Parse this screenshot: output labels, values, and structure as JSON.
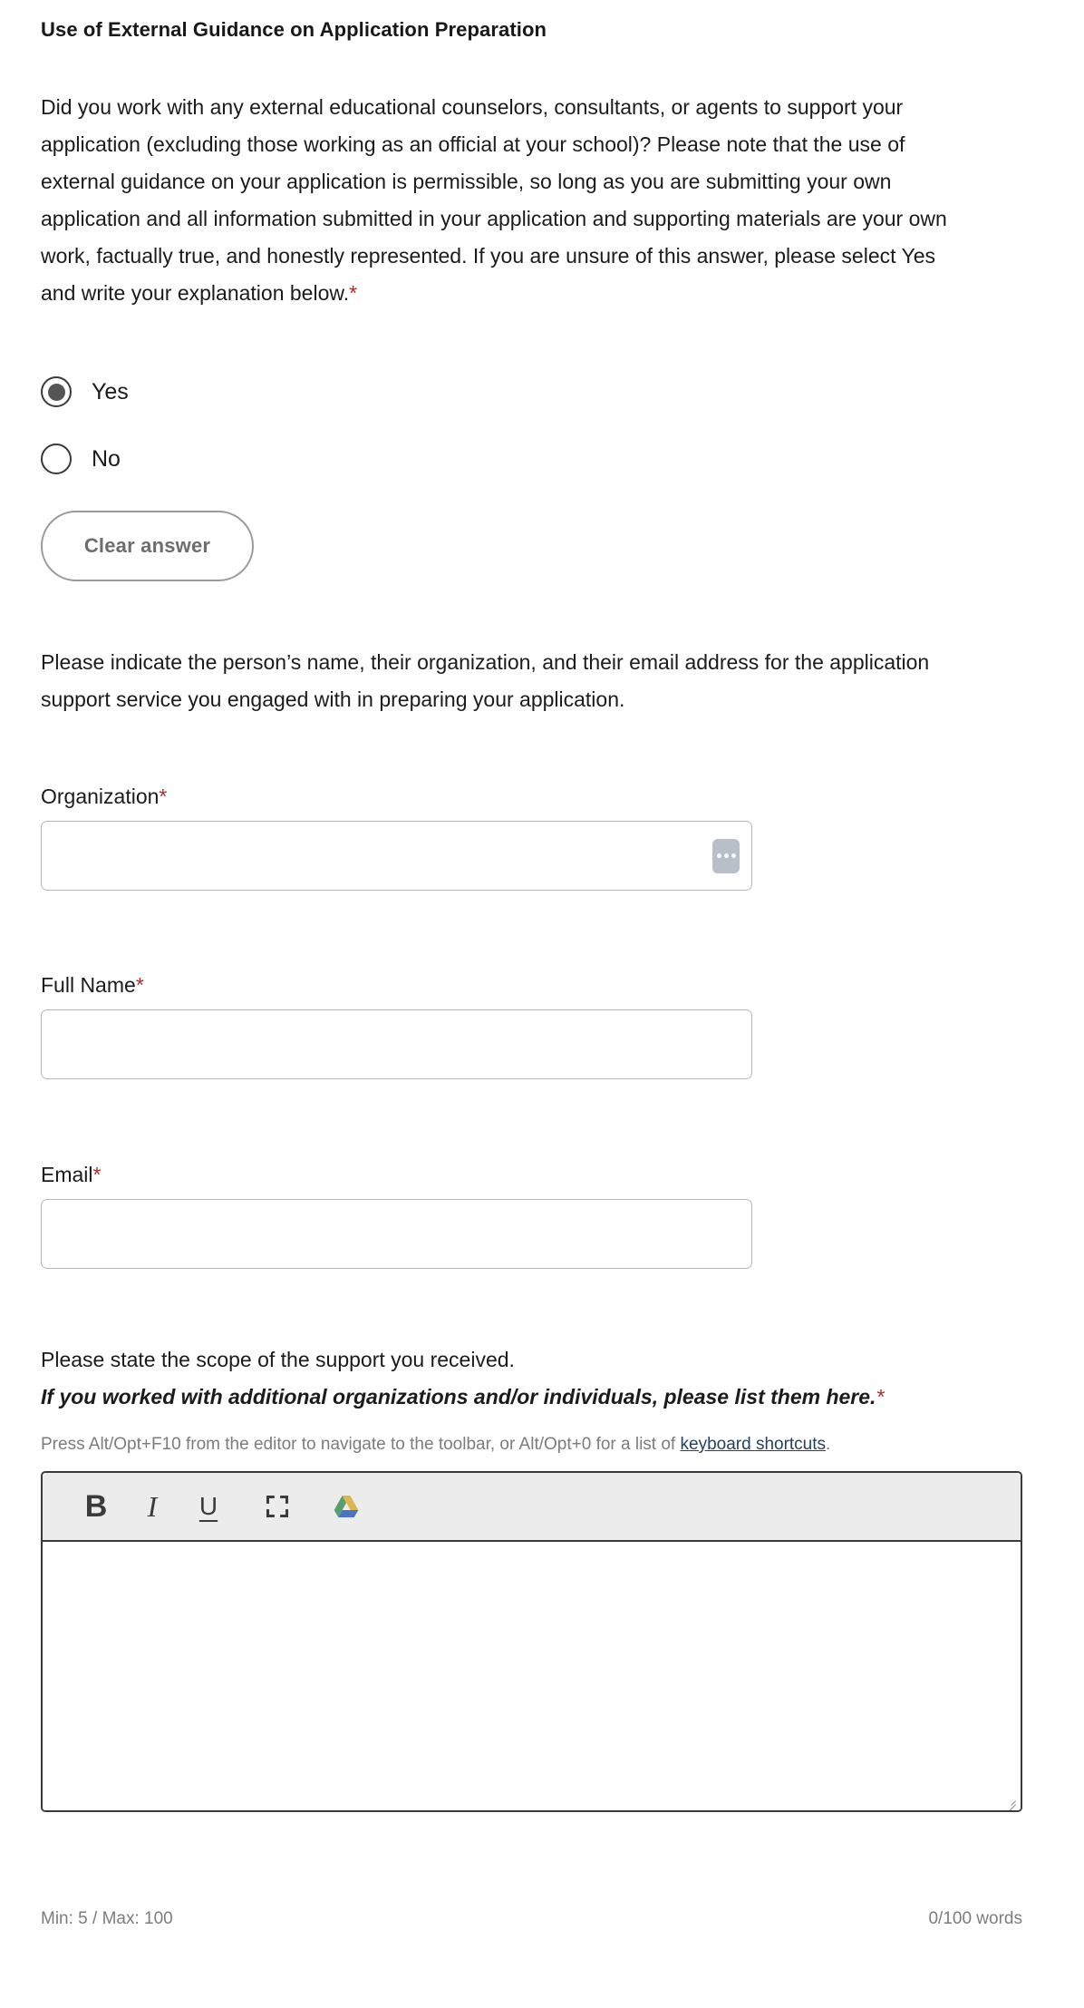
{
  "section": {
    "title": "Use of External Guidance on Application Preparation"
  },
  "question": {
    "text": "Did you work with any external educational counselors, consultants, or agents to support your application (excluding those working as an official at your school)? Please note that the use of external guidance on your application is permissible, so long as you are submitting your own application and all information submitted in your application and supporting materials are your own work, factually true, and honestly represented. If you are unsure of this answer, please select Yes and write your explanation below.",
    "required_marker": "*",
    "options": [
      {
        "label": "Yes",
        "selected": true
      },
      {
        "label": "No",
        "selected": false
      }
    ],
    "clear_answer_label": "Clear answer"
  },
  "sub_prompt": {
    "text": "Please indicate the person’s name, their organization, and their email address for the application support service you engaged with in preparing your application."
  },
  "fields": {
    "organization": {
      "label": "Organization",
      "required_marker": "*",
      "value": "",
      "placeholder": "",
      "badge_icon": "ellipsis-autofill-icon"
    },
    "full_name": {
      "label": "Full Name",
      "required_marker": "*",
      "value": "",
      "placeholder": ""
    },
    "email": {
      "label": "Email",
      "required_marker": "*",
      "value": "",
      "placeholder": ""
    }
  },
  "scope": {
    "line1": "Please state the scope of the support you received.",
    "line2": "If you worked with additional organizations and/or individuals, please list them here.",
    "required_marker": "*",
    "help_prefix": "Press Alt/Opt+F10 from the editor to navigate to the toolbar, or Alt/Opt+0 for a list of ",
    "help_link": "keyboard shortcuts",
    "help_suffix": "."
  },
  "editor": {
    "toolbar": [
      {
        "name": "bold-icon",
        "glyph": "B"
      },
      {
        "name": "italic-icon",
        "glyph": "I"
      },
      {
        "name": "underline-icon",
        "glyph": "U"
      },
      {
        "name": "fullscreen-icon",
        "glyph": ""
      },
      {
        "name": "google-drive-icon",
        "glyph": ""
      }
    ],
    "content": "",
    "min_max_label": "Min: 5 / Max: 100",
    "word_count_label": "0/100 words"
  },
  "colors": {
    "required_red": "#b12a2a",
    "link_blue": "#27425e",
    "muted_gray": "#7c7c7c",
    "toolbar_bg": "#ececec",
    "border_dark": "#3b3b3b",
    "badge_gray": "#b9bfc8"
  }
}
